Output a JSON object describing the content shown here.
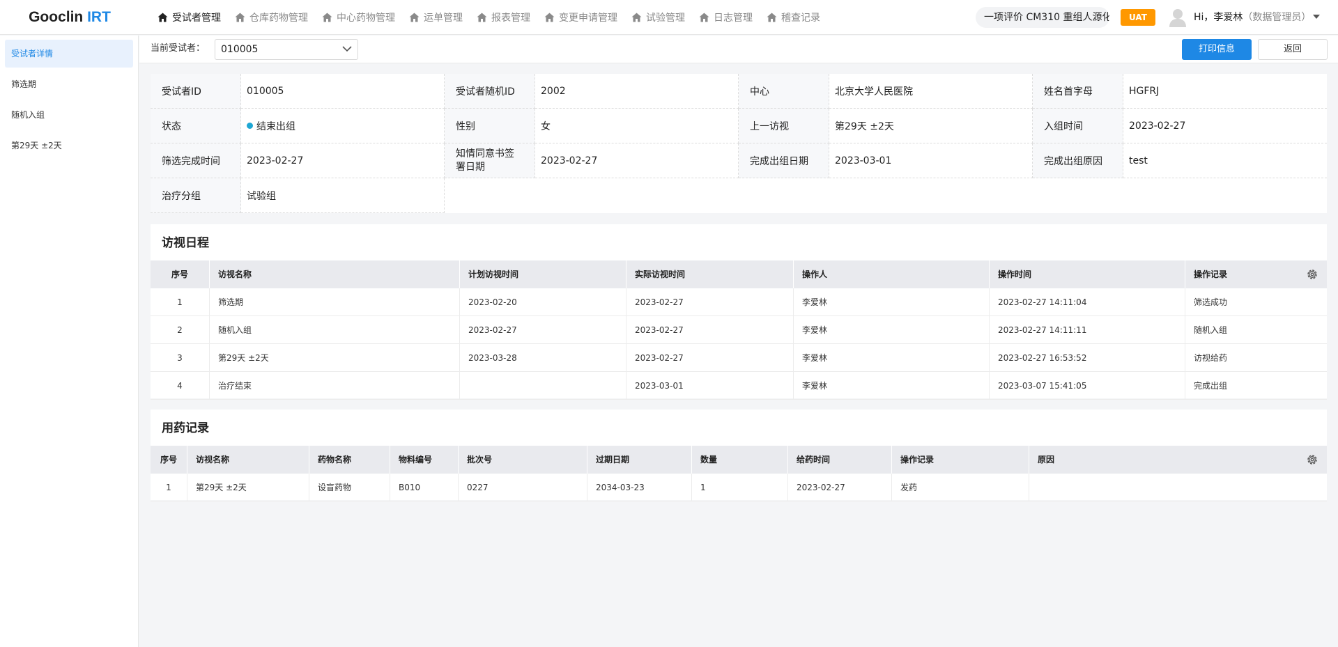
{
  "app": {
    "logo_main": "Gooclin ",
    "logo_accent": "IRT"
  },
  "nav": [
    {
      "label": "受试者管理",
      "active": true
    },
    {
      "label": "仓库药物管理"
    },
    {
      "label": "中心药物管理"
    },
    {
      "label": "运单管理"
    },
    {
      "label": "报表管理"
    },
    {
      "label": "变更申请管理"
    },
    {
      "label": "试验管理"
    },
    {
      "label": "日志管理"
    },
    {
      "label": "稽查记录"
    }
  ],
  "header": {
    "project": "一项评价 CM310 重组人源化",
    "env_badge": "UAT",
    "greeting": "Hi，李爱林",
    "role": "（数据管理员）"
  },
  "sidebar": {
    "items": [
      {
        "label": "受试者详情"
      },
      {
        "label": "筛选期"
      },
      {
        "label": "随机入组"
      },
      {
        "label": "第29天 ±2天"
      }
    ]
  },
  "subhead": {
    "label": "当前受试者：",
    "subject": "010005",
    "print_button": "打印信息",
    "back_button": "返回"
  },
  "info": {
    "subject_id_label": "受试者ID",
    "subject_id": "010005",
    "random_id_label": "受试者随机ID",
    "random_id": "2002",
    "center_label": "中心",
    "center": "北京大学人民医院",
    "initials_label": "姓名首字母",
    "initials": "HGFRJ",
    "status_label": "状态",
    "status": "结束出组",
    "gender_label": "性别",
    "gender": "女",
    "last_visit_label": "上一访视",
    "last_visit": "第29天 ±2天",
    "enroll_time_label": "入组时间",
    "enroll_time": "2023-02-27",
    "screen_done_label": "筛选完成时间",
    "screen_done": "2023-02-27",
    "consent_label_1": "知情同意书签",
    "consent_label_2": "署日期",
    "consent_date": "2023-02-27",
    "exit_date_label": "完成出组日期",
    "exit_date": "2023-03-01",
    "exit_reason_label": "完成出组原因",
    "exit_reason": "test",
    "group_label": "治疗分组",
    "group": "试验组",
    "status_color": "#1ea7d4"
  },
  "visits": {
    "title": "访视日程",
    "columns": [
      "序号",
      "访视名称",
      "计划访视时间",
      "实际访视时间",
      "操作人",
      "操作时间",
      "操作记录"
    ],
    "rows": [
      [
        "1",
        "筛选期",
        "2023-02-20",
        "2023-02-27",
        "李爱林",
        "2023-02-27 14:11:04",
        "筛选成功"
      ],
      [
        "2",
        "随机入组",
        "2023-02-27",
        "2023-02-27",
        "李爱林",
        "2023-02-27 14:11:11",
        "随机入组"
      ],
      [
        "3",
        "第29天 ±2天",
        "2023-03-28",
        "2023-02-27",
        "李爱林",
        "2023-02-27 16:53:52",
        "访视给药"
      ],
      [
        "4",
        "治疗结束",
        "",
        "2023-03-01",
        "李爱林",
        "2023-03-07 15:41:05",
        "完成出组"
      ]
    ]
  },
  "dosing": {
    "title": "用药记录",
    "columns": [
      "序号",
      "访视名称",
      "药物名称",
      "物料编号",
      "批次号",
      "过期日期",
      "数量",
      "给药时间",
      "操作记录",
      "原因"
    ],
    "rows": [
      [
        "1",
        "第29天 ±2天",
        "设盲药物",
        "B010",
        "0227",
        "2034-03-23",
        "1",
        "2023-02-27",
        "发药",
        ""
      ]
    ]
  },
  "colors": {
    "accent": "#1e88e5",
    "badge": "#ff9800"
  }
}
